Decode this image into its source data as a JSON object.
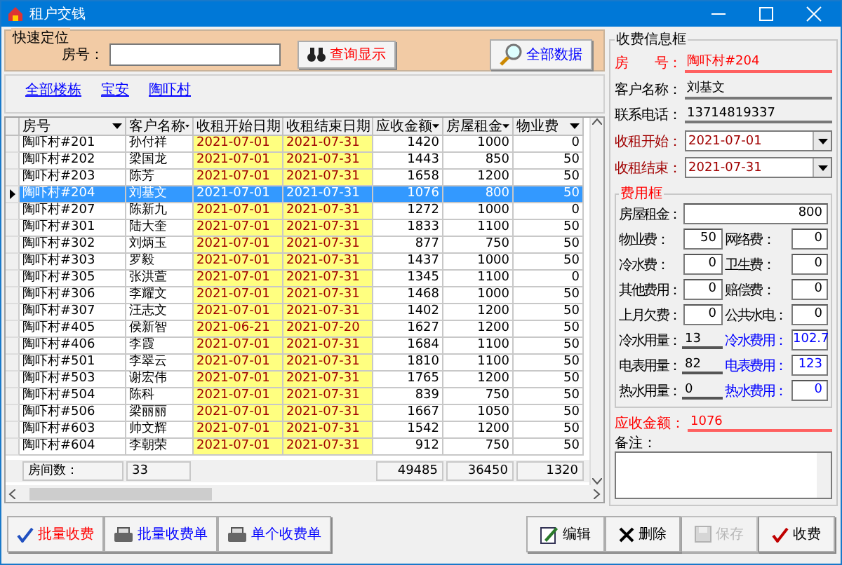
{
  "window": {
    "title": "租户交钱"
  },
  "search": {
    "title": "快速定位",
    "label": "房号：",
    "query_button": "查询显示",
    "all_button": "全部数据"
  },
  "links": [
    {
      "label": "全部楼栋"
    },
    {
      "label": "宝安"
    },
    {
      "label": "陶吓村"
    }
  ],
  "table": {
    "columns": [
      "房号",
      "客户名称",
      "收租开始日期",
      "收租结束日期",
      "应收金额",
      "房屋租金",
      "物业费"
    ],
    "rows": [
      {
        "selected": false,
        "cells": [
          "陶吓村#201",
          "孙付祥",
          "2021-07-01",
          "2021-07-31",
          "1420",
          "1000",
          "0"
        ]
      },
      {
        "selected": false,
        "cells": [
          "陶吓村#202",
          "梁国龙",
          "2021-07-01",
          "2021-07-31",
          "1443",
          "850",
          "50"
        ]
      },
      {
        "selected": false,
        "cells": [
          "陶吓村#203",
          "陈芳",
          "2021-07-01",
          "2021-07-31",
          "1658",
          "1200",
          "50"
        ]
      },
      {
        "selected": true,
        "cells": [
          "陶吓村#204",
          "刘基文",
          "2021-07-01",
          "2021-07-31",
          "1076",
          "800",
          "50"
        ]
      },
      {
        "selected": false,
        "cells": [
          "陶吓村#207",
          "陈新九",
          "2021-07-01",
          "2021-07-31",
          "1272",
          "1000",
          "0"
        ]
      },
      {
        "selected": false,
        "cells": [
          "陶吓村#301",
          "陆大奎",
          "2021-07-01",
          "2021-07-31",
          "1833",
          "1100",
          "50"
        ]
      },
      {
        "selected": false,
        "cells": [
          "陶吓村#302",
          "刘炳玉",
          "2021-07-01",
          "2021-07-31",
          "877",
          "750",
          "50"
        ]
      },
      {
        "selected": false,
        "cells": [
          "陶吓村#303",
          "罗毅",
          "2021-07-01",
          "2021-07-31",
          "1437",
          "1000",
          "50"
        ]
      },
      {
        "selected": false,
        "cells": [
          "陶吓村#305",
          "张洪萱",
          "2021-07-01",
          "2021-07-31",
          "1345",
          "1100",
          "0"
        ]
      },
      {
        "selected": false,
        "cells": [
          "陶吓村#306",
          "李耀文",
          "2021-07-01",
          "2021-07-31",
          "1468",
          "1000",
          "50"
        ]
      },
      {
        "selected": false,
        "cells": [
          "陶吓村#307",
          "汪志文",
          "2021-07-01",
          "2021-07-31",
          "1402",
          "1200",
          "50"
        ]
      },
      {
        "selected": false,
        "cells": [
          "陶吓村#405",
          "侯新智",
          "2021-06-21",
          "2021-07-20",
          "1627",
          "1200",
          "50"
        ]
      },
      {
        "selected": false,
        "cells": [
          "陶吓村#406",
          "李霞",
          "2021-07-01",
          "2021-07-31",
          "1684",
          "1100",
          "50"
        ]
      },
      {
        "selected": false,
        "cells": [
          "陶吓村#501",
          "李翠云",
          "2021-07-01",
          "2021-07-31",
          "1810",
          "1100",
          "50"
        ]
      },
      {
        "selected": false,
        "cells": [
          "陶吓村#503",
          "谢宏伟",
          "2021-07-01",
          "2021-07-31",
          "1765",
          "1200",
          "50"
        ]
      },
      {
        "selected": false,
        "cells": [
          "陶吓村#504",
          "陈科",
          "2021-07-01",
          "2021-07-31",
          "839",
          "750",
          "50"
        ]
      },
      {
        "selected": false,
        "cells": [
          "陶吓村#506",
          "梁丽丽",
          "2021-07-01",
          "2021-07-31",
          "1667",
          "1050",
          "50"
        ]
      },
      {
        "selected": false,
        "cells": [
          "陶吓村#603",
          "帅文辉",
          "2021-07-01",
          "2021-07-31",
          "1542",
          "1200",
          "50"
        ]
      },
      {
        "selected": false,
        "cells": [
          "陶吓村#604",
          "李朝荣",
          "2021-07-01",
          "2021-07-31",
          "912",
          "750",
          "50"
        ]
      }
    ],
    "footer": {
      "label": "房间数：",
      "count": "33",
      "totals": [
        "49485",
        "36450",
        "1320"
      ]
    }
  },
  "left_buttons": [
    {
      "label": "批量收费",
      "color": "#ff0000"
    },
    {
      "label": "批量收费单",
      "color": "#0000ff"
    },
    {
      "label": "单个收费单",
      "color": "#0000ff"
    }
  ],
  "info": {
    "title": "收费信息框",
    "fields": [
      {
        "label": "房　　号：",
        "value": "陶吓村#204",
        "kind": "line",
        "highlight": true
      },
      {
        "label": "客户名称：",
        "value": "刘基文",
        "kind": "line",
        "highlight": false
      },
      {
        "label": "联系电话：",
        "value": "13714819337",
        "kind": "line",
        "highlight": false
      },
      {
        "label": "收租开始：",
        "value": "2021-07-01",
        "kind": "select",
        "highlight": true
      },
      {
        "label": "收租结束：",
        "value": "2021-07-31",
        "kind": "select",
        "highlight": true
      }
    ],
    "fees": {
      "title": "费用框",
      "rows": [
        [
          {
            "label": "房屋租金：",
            "value": "800",
            "kind": "wide",
            "highlight": false
          }
        ],
        [
          {
            "label": "物业费：",
            "value": "50",
            "kind": "box",
            "highlight": false
          },
          {
            "label": "网络费：",
            "value": "0",
            "kind": "box",
            "highlight": false
          }
        ],
        [
          {
            "label": "冷水费：",
            "value": "0",
            "kind": "box",
            "highlight": false
          },
          {
            "label": "卫生费：",
            "value": "0",
            "kind": "box",
            "highlight": false
          }
        ],
        [
          {
            "label": "其他费用：",
            "value": "0",
            "kind": "box",
            "highlight": false
          },
          {
            "label": "赔偿费：",
            "value": "0",
            "kind": "box",
            "highlight": false
          }
        ],
        [
          {
            "label": "上月欠费：",
            "value": "0",
            "kind": "box",
            "highlight": false
          },
          {
            "label": "公共水电：",
            "value": "0",
            "kind": "box",
            "highlight": false
          }
        ],
        [
          {
            "label": "冷水用量：",
            "value": "13",
            "kind": "line",
            "highlight": false
          },
          {
            "label": "冷水费用：",
            "value": "102.7",
            "kind": "box",
            "highlight": true
          }
        ],
        [
          {
            "label": "电表用量：",
            "value": "82",
            "kind": "line",
            "highlight": false
          },
          {
            "label": "电表费用：",
            "value": "123",
            "kind": "box",
            "highlight": true
          }
        ],
        [
          {
            "label": "热水用量：",
            "value": "0",
            "kind": "line",
            "highlight": false
          },
          {
            "label": "热水费用：",
            "value": "0",
            "kind": "box",
            "highlight": true
          }
        ]
      ]
    },
    "total": {
      "label": "应收金额：",
      "value": "1076"
    },
    "note": {
      "label": "备注："
    }
  },
  "right_buttons": [
    {
      "label": "编辑",
      "disabled": false
    },
    {
      "label": "删除",
      "disabled": false
    },
    {
      "label": "保存",
      "disabled": true
    },
    {
      "label": "收费",
      "disabled": false
    }
  ]
}
